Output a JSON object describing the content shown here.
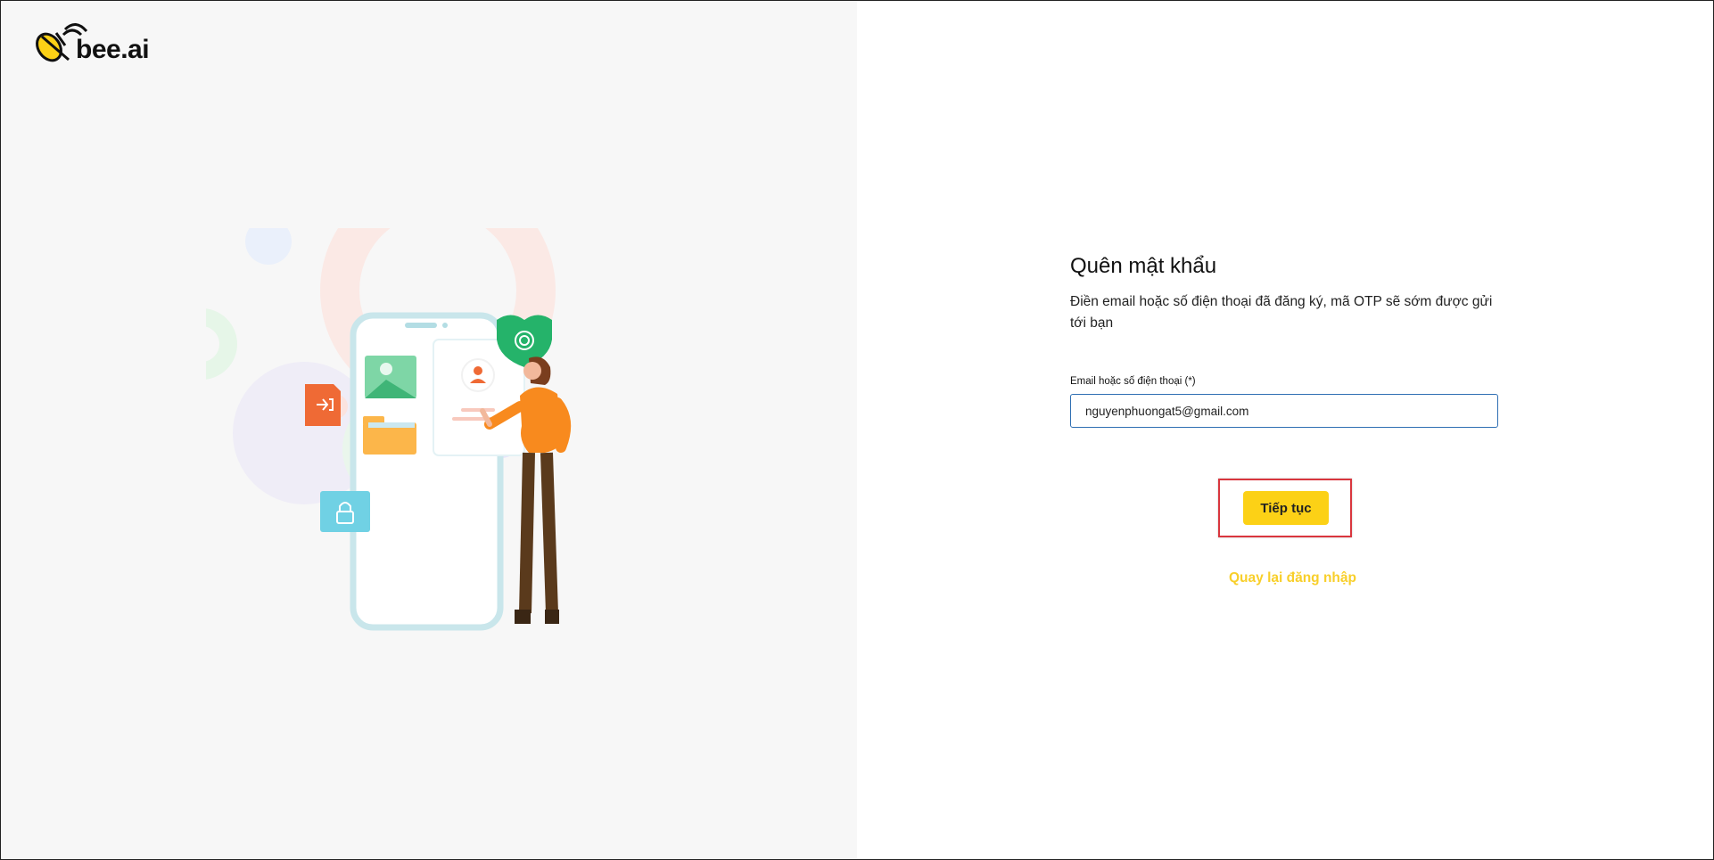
{
  "brand": {
    "logo_text": "bee.ai"
  },
  "form": {
    "title": "Quên mật khẩu",
    "subtitle": "Điền email hoặc số điện thoại đã đăng ký, mã OTP sẽ sớm được gửi tới bạn",
    "field_label": "Email hoặc số điện thoại (*)",
    "field_value": "nguyenphuongat5@gmail.com",
    "submit_label": "Tiếp tục",
    "back_link_label": "Quay lại đăng nhập"
  },
  "colors": {
    "accent": "#fcd116",
    "link": "#f8cf2a",
    "input_border": "#2f6fb3",
    "highlight": "#d9363e"
  },
  "icons": [
    "bee-logo-icon",
    "fingerprint-shield-icon",
    "login-file-icon",
    "lock-icon",
    "user-icon",
    "folder-icon",
    "image-icon"
  ]
}
